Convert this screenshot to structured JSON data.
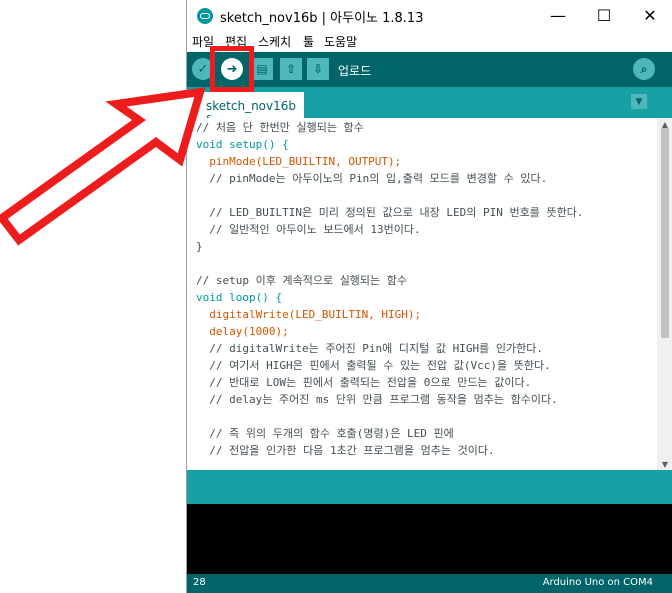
{
  "window": {
    "title": "sketch_nov16b | 아두이노 1.8.13",
    "minimize_glyph": "—",
    "maximize_glyph": "☐",
    "close_glyph": "✕"
  },
  "menu": [
    "파일",
    "편집",
    "스케치",
    "툴",
    "도움말"
  ],
  "toolbar": {
    "verify_glyph": "✓",
    "upload_glyph": "➜",
    "new_glyph": "▤",
    "open_glyph": "⇧",
    "save_glyph": "⇩",
    "hover_label": "업로드",
    "serial_glyph": "⌕"
  },
  "tab": {
    "name": "sketch_nov16b §",
    "menu_glyph": "▼"
  },
  "code": [
    "// 처음 단 한번만 실행되는 함수",
    "void setup() {",
    "  pinMode(LED_BUILTIN, OUTPUT);",
    "  // pinMode는 아두이노의 Pin의 입,출력 모드를 변경할 수 있다.",
    "",
    "  // LED_BUILTIN은 미리 정의된 값으로 내장 LED의 PIN 번호를 뜻한다.",
    "  // 일반적인 아두이노 보드에서 13번이다.",
    "}",
    "",
    "// setup 이후 계속적으로 실행되는 함수",
    "void loop() {",
    "  digitalWrite(LED_BUILTIN, HIGH);",
    "  delay(1000);",
    "  // digitalWrite는 주어진 Pin에 디지털 값 HIGH를 인가한다.",
    "  // 여기서 HIGH은 핀에서 출력될 수 있는 전압 값(Vcc)을 뜻한다.",
    "  // 반대로 LOW는 핀에서 출력되는 전압을 0으로 만드는 값이다.",
    "  // delay는 주어진 ms 단위 만큼 프로그램 동작을 멈추는 함수이다.",
    "",
    "  // 즉 위의 두개의 함수 호출(명령)은 LED 핀에",
    "  // 전압을 인가한 다음 1초간 프로그램을 멈추는 것이다."
  ],
  "status": {
    "line": "28",
    "board": "Arduino Uno on COM4"
  },
  "colors": {
    "toolbar": "#006468",
    "tabbar": "#17a1a5",
    "highlight": "#ee1c1c"
  }
}
